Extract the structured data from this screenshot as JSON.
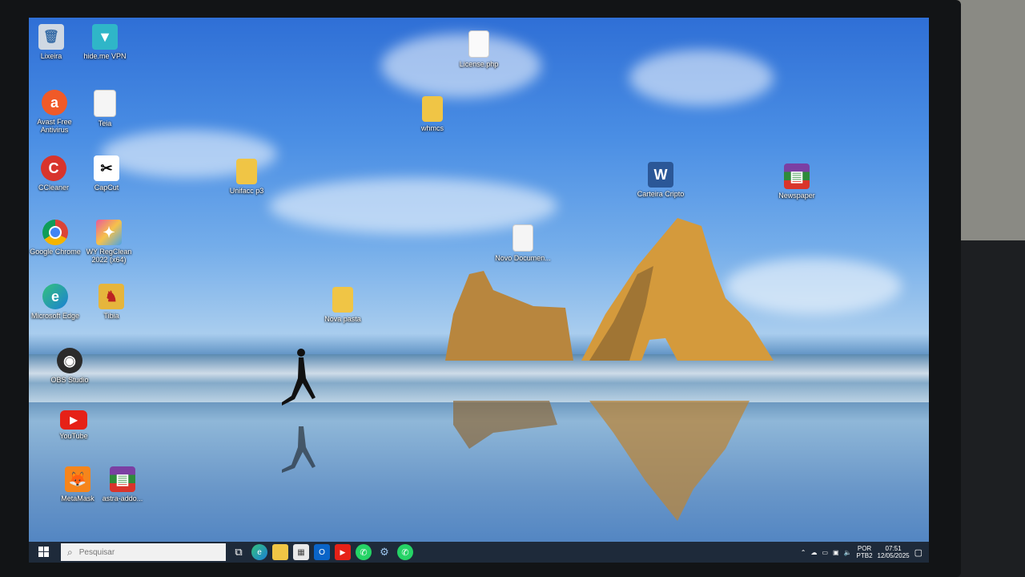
{
  "desktop_icons": [
    {
      "label": "Lixeira",
      "icon": "recycle-bin-icon"
    },
    {
      "label": "hide.me VPN",
      "icon": "vpn-icon"
    },
    {
      "label": "Avast Free Antivirus",
      "icon": "avast-icon"
    },
    {
      "label": "Teia",
      "icon": "text-file-icon"
    },
    {
      "label": "CCleaner",
      "icon": "ccleaner-icon"
    },
    {
      "label": "CapCut",
      "icon": "capcut-icon"
    },
    {
      "label": "Google Chrome",
      "icon": "chrome-icon"
    },
    {
      "label": "WY RegClean 2022 (x64)",
      "icon": "regclean-icon"
    },
    {
      "label": "Microsoft Edge",
      "icon": "edge-icon"
    },
    {
      "label": "Tibia",
      "icon": "tibia-icon"
    },
    {
      "label": "OBS Studio",
      "icon": "obs-icon"
    },
    {
      "label": "YouTube",
      "icon": "youtube-icon"
    },
    {
      "label": "MetaMask",
      "icon": "metamask-icon"
    },
    {
      "label": "astra-addo...",
      "icon": "winrar-icon"
    },
    {
      "label": "License.php",
      "icon": "file-icon"
    },
    {
      "label": "whmcs",
      "icon": "folder-icon"
    },
    {
      "label": "Unifacc p3",
      "icon": "folder-icon"
    },
    {
      "label": "Novo Documen...",
      "icon": "text-file-icon"
    },
    {
      "label": "Nova pasta",
      "icon": "folder-icon"
    },
    {
      "label": "Carteira Cripto",
      "icon": "word-icon"
    },
    {
      "label": "Newspaper",
      "icon": "winrar-icon"
    }
  ],
  "taskbar": {
    "search_placeholder": "Pesquisar",
    "apps": [
      "task-view-icon",
      "edge-icon",
      "file-explorer-icon",
      "store-icon",
      "outlook-icon",
      "youtube-icon",
      "whatsapp-icon",
      "network-app-icon",
      "whatsapp-icon"
    ],
    "language_top": "POR",
    "language_bottom": "PTB2",
    "time": "07:51",
    "date": "12/05/2025"
  },
  "colors": {
    "taskbar": "#1e2a3a",
    "accent": "#2f6fd6"
  }
}
